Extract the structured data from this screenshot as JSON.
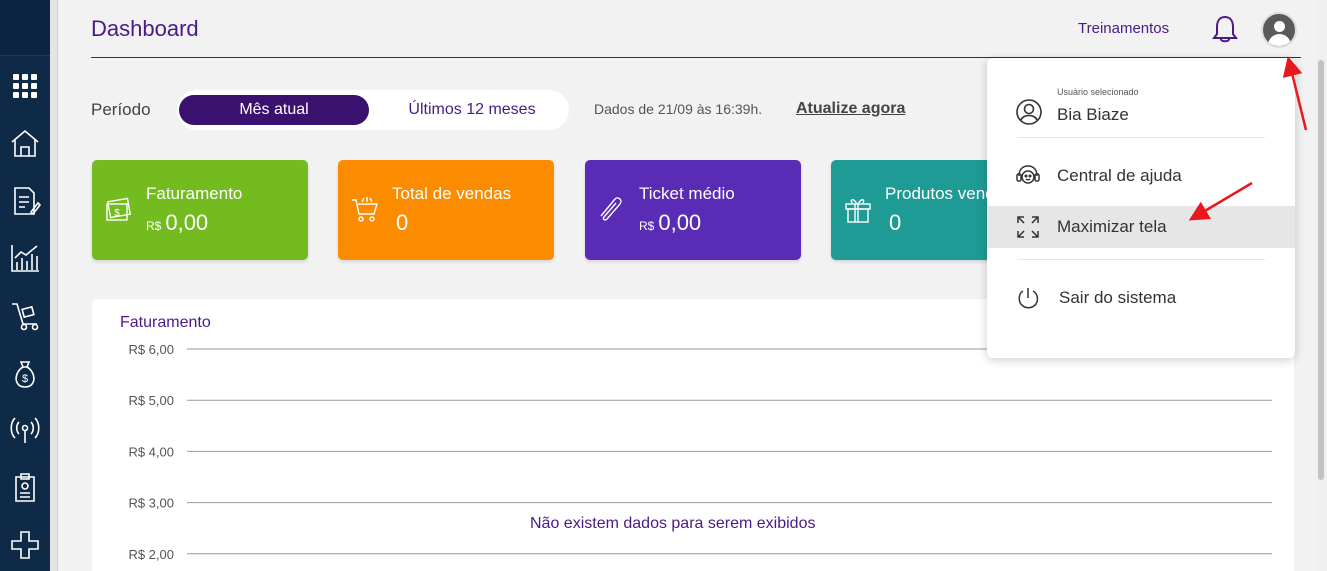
{
  "colors": {
    "sidebar_bg": "#0f2a47",
    "brand_purple": "#4b1a86",
    "card_faturamento": "#74bb1f",
    "card_vendas": "#fb8c00",
    "card_ticket": "#5a2bb5",
    "card_produtos": "#1f9b96",
    "annotation_arrow": "#e8181c"
  },
  "sidebar": {
    "items": [
      {
        "icon": "grid-icon"
      },
      {
        "icon": "home-icon"
      },
      {
        "icon": "document-edit-icon"
      },
      {
        "icon": "bar-chart-icon"
      },
      {
        "icon": "hand-truck-icon"
      },
      {
        "icon": "money-bag-icon"
      },
      {
        "icon": "antenna-icon"
      },
      {
        "icon": "clipboard-icon"
      },
      {
        "icon": "plus-cross-icon"
      }
    ]
  },
  "header": {
    "title": "Dashboard",
    "treinamentos": "Treinamentos",
    "bell_icon": "bell-icon",
    "avatar_icon": "user-avatar-icon"
  },
  "period": {
    "label": "Período",
    "active": "Mês atual",
    "other": "Últimos 12 meses",
    "data_stamp": "Dados de 21/09 às 16:39h.",
    "update_link": "Atualize agora"
  },
  "cards": [
    {
      "title": "Faturamento",
      "currency": "R$",
      "value": "0,00",
      "icon": "money-cash-icon"
    },
    {
      "title": "Total de vendas",
      "currency": "",
      "value": "0",
      "icon": "shopping-cart-icon"
    },
    {
      "title": "Ticket médio",
      "currency": "R$",
      "value": "0,00",
      "icon": "tag-icon"
    },
    {
      "title": "Produtos vendidos",
      "currency": "",
      "value": "0",
      "icon": "gift-icon"
    }
  ],
  "chart_data": {
    "type": "line",
    "title": "Faturamento",
    "y_ticks": [
      "R$ 6,00",
      "R$ 5,00",
      "R$ 4,00",
      "R$ 3,00",
      "R$ 2,00"
    ],
    "series": [],
    "empty_message": "Não existem dados para serem exibidos"
  },
  "dropdown": {
    "user_label": "Usuário selecionado",
    "user_name": "Bia Biaze",
    "items": [
      {
        "label": "Central de ajuda",
        "icon": "headset-support-icon"
      },
      {
        "label": "Maximizar tela",
        "icon": "fullscreen-icon"
      },
      {
        "label": "Sair do sistema",
        "icon": "power-icon"
      }
    ]
  }
}
